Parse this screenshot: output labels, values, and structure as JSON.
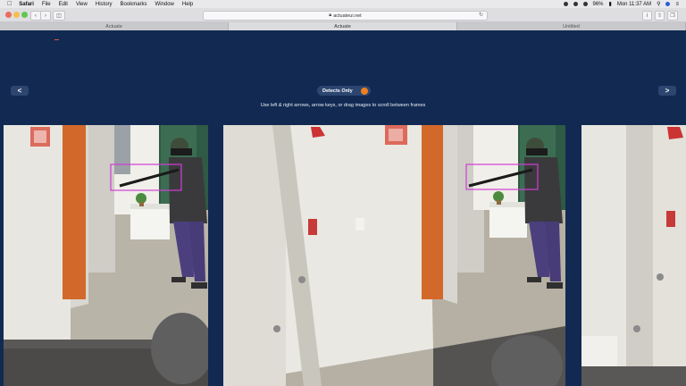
{
  "menubar": {
    "app": "Safari",
    "items": [
      "File",
      "Edit",
      "View",
      "History",
      "Bookmarks",
      "Window",
      "Help"
    ],
    "battery": "96%",
    "clock": "Mon 11:37 AM"
  },
  "browser": {
    "url": "actuateui.net",
    "tabs": [
      {
        "label": "Actuate",
        "active": false
      },
      {
        "label": "Actuate",
        "active": true
      },
      {
        "label": "Untitled",
        "active": false
      }
    ]
  },
  "page": {
    "prev_label": "<",
    "next_label": ">",
    "toggle_label": "Detects Only",
    "toggle_on": true,
    "instructions": "Use left & right arrows, arrow keys, or drag images to scroll between frames",
    "accent": "#f0801f",
    "background": "#122a52",
    "detection_box_color": "#d23cd8"
  },
  "frames": [
    {
      "name": "frame-left",
      "content": "cctv-hallway-person-with-rifle",
      "detection": true
    },
    {
      "name": "frame-center",
      "content": "cctv-hallway-person-with-rifle",
      "detection": true
    },
    {
      "name": "frame-right",
      "content": "cctv-hallway-door",
      "detection": false
    }
  ]
}
